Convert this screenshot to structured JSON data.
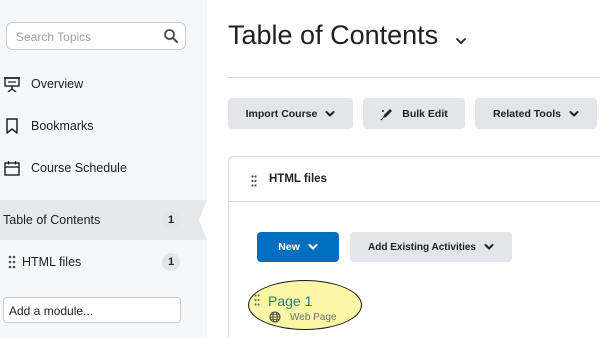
{
  "sidebar": {
    "search_placeholder": "Search Topics",
    "items": [
      {
        "label": "Overview",
        "icon": "presentation-icon"
      },
      {
        "label": "Bookmarks",
        "icon": "bookmark-icon"
      },
      {
        "label": "Course Schedule",
        "icon": "calendar-icon"
      },
      {
        "label": "Table of Contents",
        "count": "1",
        "selected": true
      },
      {
        "label": "HTML files",
        "count": "1",
        "icon": "drag-handle-icon"
      }
    ],
    "add_module_placeholder": "Add a module..."
  },
  "main": {
    "title": "Table of Contents",
    "toolbar": {
      "import_course": "Import Course",
      "bulk_edit": "Bulk Edit",
      "related_tools": "Related Tools"
    },
    "module": {
      "name": "HTML files",
      "new_label": "New",
      "add_existing_label": "Add Existing Activities",
      "topics": [
        {
          "title": "Page 1",
          "type": "Web Page",
          "icon": "globe-icon"
        }
      ]
    }
  },
  "colors": {
    "primary_button": "#006fbf",
    "topic_link": "#2f7d74",
    "highlight": "#fbf7a6",
    "sidebar_bg": "#f6f7f8"
  }
}
